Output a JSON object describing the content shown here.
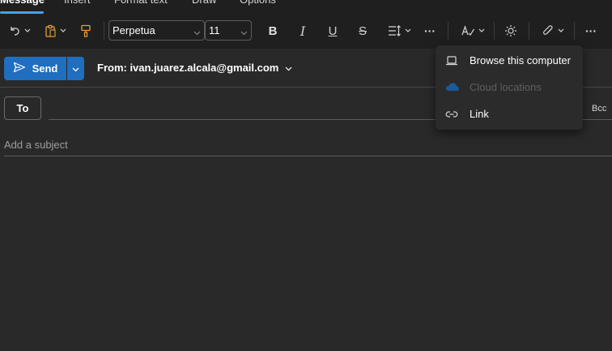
{
  "tabs": [
    {
      "label": "Message",
      "active": true
    },
    {
      "label": "Insert",
      "active": false
    },
    {
      "label": "Format text",
      "active": false
    },
    {
      "label": "Draw",
      "active": false
    },
    {
      "label": "Options",
      "active": false
    }
  ],
  "ribbon": {
    "font_name": "Perpetua",
    "font_size": "11",
    "bold_label": "B",
    "italic_label": "I",
    "underline_label": "U",
    "strike_label": "S",
    "more_label": "···",
    "overflow_label": "···",
    "accent_color": "#e8a03b"
  },
  "compose": {
    "send_label": "Send",
    "from_label": "From: ivan.juarez.alcala@gmail.com",
    "to_label": "To",
    "bcc_label": "Bcc",
    "subject_placeholder": "Add a subject",
    "send_color": "#1f6ebf"
  },
  "attach_menu": {
    "items": [
      {
        "label": "Browse this computer",
        "icon": "laptop-icon",
        "enabled": true
      },
      {
        "label": "Cloud locations",
        "icon": "cloud-icon",
        "enabled": false
      },
      {
        "label": "Link",
        "icon": "link-icon",
        "enabled": true
      }
    ]
  }
}
